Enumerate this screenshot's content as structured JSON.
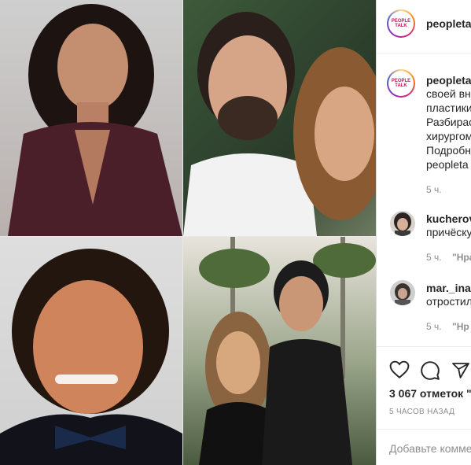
{
  "post": {
    "account": "peopleta",
    "logo_text_line1": "PEOPLE",
    "logo_text_line2": "TALK"
  },
  "caption": {
    "user": "peopleta",
    "lines": [
      "своей вн",
      "пластики",
      "Разбирас",
      "хирургом",
      "Подробн",
      "peopleta"
    ],
    "time": "5 ч."
  },
  "comments": [
    {
      "user": "kucherov",
      "text": "причёску",
      "time": "5 ч.",
      "reply": "\"Нра"
    },
    {
      "user": "mar._ina0",
      "text": "отростил",
      "time": "5 ч.",
      "reply": "\"Нр"
    }
  ],
  "actions": {
    "like_icon": "heart-icon",
    "comment_icon": "comment-icon",
    "share_icon": "share-icon"
  },
  "likes": "3 067 отметок \"Н",
  "posted_ago": "5 ЧАСОВ НАЗАД",
  "add_comment_placeholder": "Добавьте комме"
}
